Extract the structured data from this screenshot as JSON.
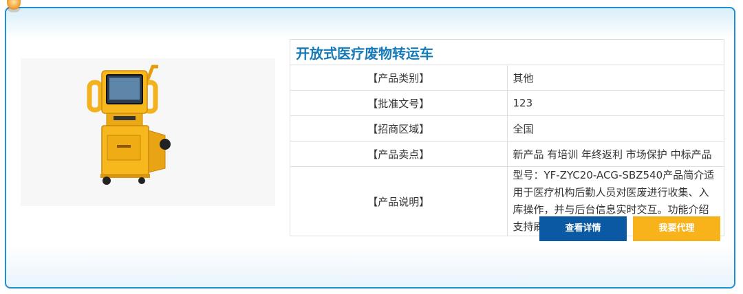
{
  "product": {
    "title": "开放式医疗废物转运车",
    "fields": [
      {
        "label": "【产品类别】",
        "value": "其他"
      },
      {
        "label": "【批准文号】",
        "value": "123"
      },
      {
        "label": "【招商区域】",
        "value": "全国"
      },
      {
        "label": "【产品卖点】",
        "value": "新产品 有培训 年终返利 市场保护 中标产品"
      },
      {
        "label": "【产品说明】",
        "value": "型号：YF-ZYC20-ACG-SBZ540产品简介适用于医疗机构后勤人员对医废进行收集、入库操作，并与后台信息实时交互。功能介绍支持刷卡"
      }
    ]
  },
  "actions": {
    "detail_label": "查看详情",
    "agent_label": "我要代理"
  },
  "colors": {
    "border": "#1e8fd0",
    "title": "#1679b8",
    "detail_button": "#0b58a3",
    "agent_button": "#f8b31a",
    "cart_body": "#f6b81c"
  }
}
